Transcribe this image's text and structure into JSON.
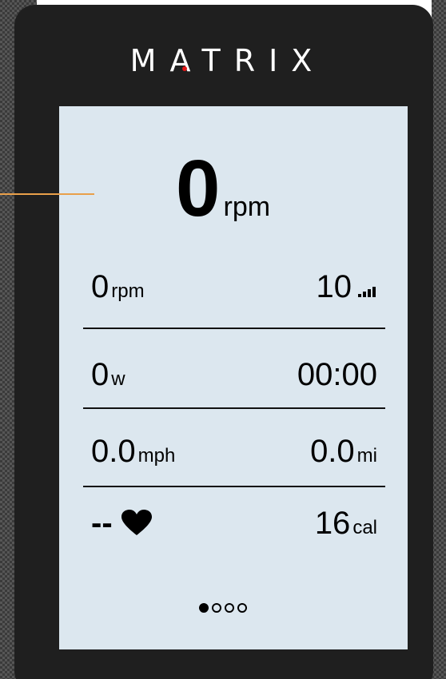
{
  "brand": {
    "name": "MATRIX",
    "accent_dot_color": "#e01818"
  },
  "primary": {
    "value": "0",
    "unit": "rpm"
  },
  "rows": [
    {
      "left": {
        "value": "0",
        "unit": "rpm"
      },
      "right": {
        "value": "10",
        "unit": "",
        "icon": "resistance-level-icon"
      }
    },
    {
      "left": {
        "value": "0",
        "unit": "w"
      },
      "right": {
        "value": "00:00",
        "unit": ""
      }
    },
    {
      "left": {
        "value": "0.0",
        "unit": "mph"
      },
      "right": {
        "value": "0.0",
        "unit": "mi"
      }
    },
    {
      "left": {
        "value": "--",
        "unit": "",
        "icon": "heart-icon"
      },
      "right": {
        "value": "16",
        "unit": "cal"
      }
    }
  ],
  "pager": {
    "count": 4,
    "active_index": 0
  },
  "colors": {
    "screen": "#dce7ef",
    "bezel": "#1f1f1f",
    "annotation": "#e9a04a"
  }
}
